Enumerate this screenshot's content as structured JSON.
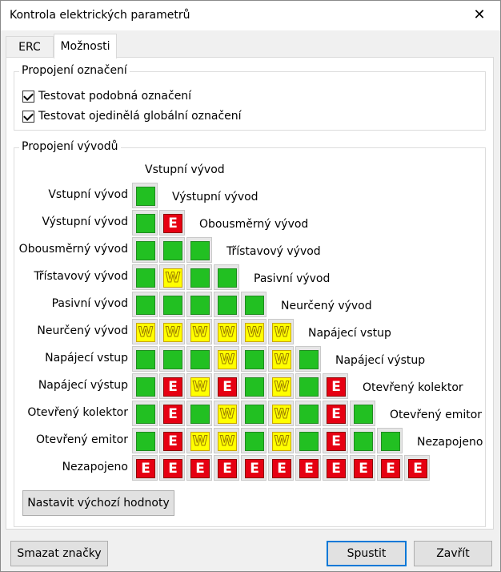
{
  "window": {
    "title": "Kontrola elektrických parametrů"
  },
  "tabs": [
    {
      "label": "ERC",
      "selected": false
    },
    {
      "label": "Možnosti",
      "selected": true
    }
  ],
  "annotations_group": {
    "title": "Propojení označení",
    "checkboxes": [
      {
        "label": "Testovat podobná označení",
        "checked": true
      },
      {
        "label": "Testovat ojedinělá globální označení",
        "checked": true
      }
    ]
  },
  "pins_group": {
    "title": "Propojení vývodů",
    "pin_types": [
      "Vstupní vývod",
      "Výstupní vývod",
      "Obousměrný vývod",
      "Třístavový vývod",
      "Pasivní vývod",
      "Neurčený vývod",
      "Napájecí vstup",
      "Napájecí výstup",
      "Otevřený kolektor",
      "Otevřený emitor",
      "Nezapojeno"
    ],
    "matrix": [
      [
        "G"
      ],
      [
        "G",
        "E"
      ],
      [
        "G",
        "G",
        "G"
      ],
      [
        "G",
        "W",
        "G",
        "G"
      ],
      [
        "G",
        "G",
        "G",
        "G",
        "G"
      ],
      [
        "W",
        "W",
        "W",
        "W",
        "W",
        "W"
      ],
      [
        "G",
        "G",
        "G",
        "W",
        "G",
        "W",
        "G"
      ],
      [
        "G",
        "E",
        "W",
        "E",
        "G",
        "W",
        "G",
        "E"
      ],
      [
        "G",
        "E",
        "G",
        "W",
        "G",
        "W",
        "G",
        "E",
        "G"
      ],
      [
        "G",
        "E",
        "W",
        "W",
        "G",
        "W",
        "G",
        "E",
        "G",
        "G"
      ],
      [
        "E",
        "E",
        "E",
        "E",
        "E",
        "E",
        "E",
        "E",
        "E",
        "E",
        "E"
      ]
    ],
    "cell_letters": {
      "E": "E",
      "W": "W",
      "G": ""
    },
    "reset_button": "Nastavit výchozí hodnoty"
  },
  "footer": {
    "clear_markers": "Smazat značky",
    "run": "Spustit",
    "close": "Zavřít"
  },
  "colors": {
    "ok": "#22c022",
    "error": "#e60012",
    "warning": "#ffff00"
  }
}
